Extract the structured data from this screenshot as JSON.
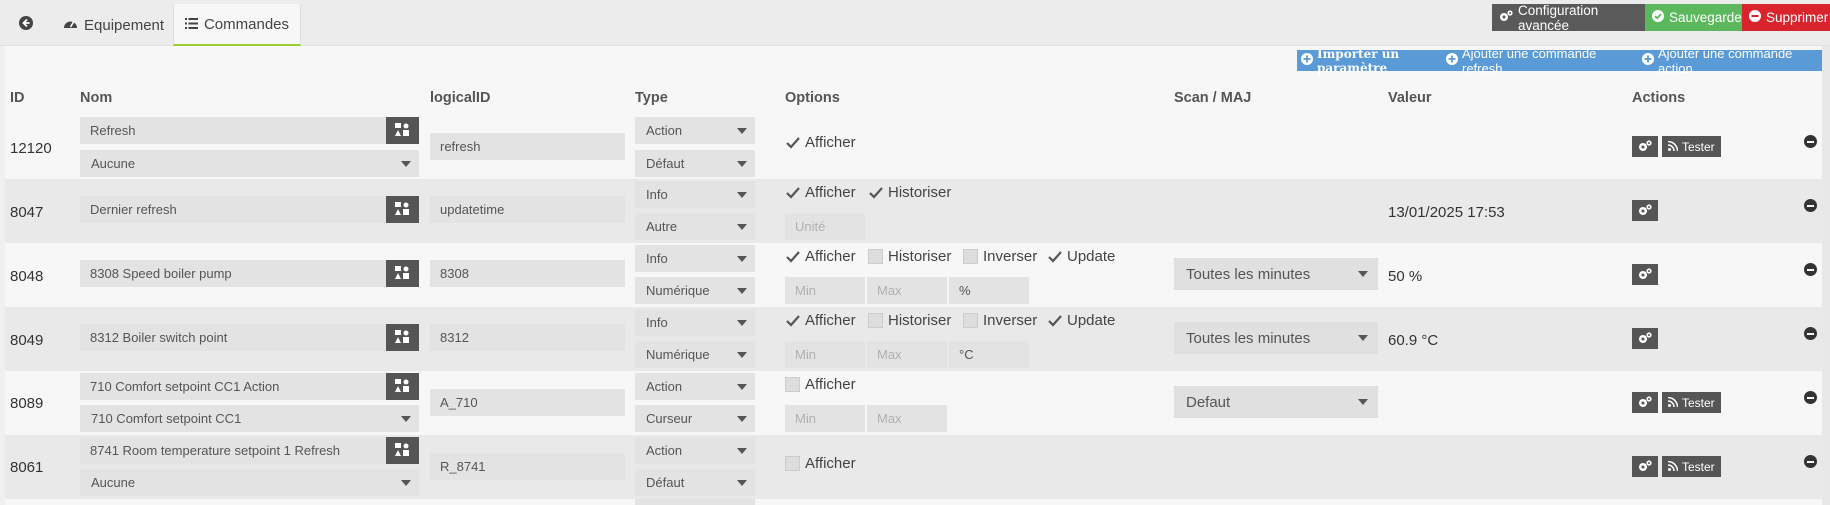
{
  "tabs": {
    "back_icon": "circle-arrow-left-icon",
    "equipement": "Equipement",
    "commandes": "Commandes"
  },
  "top_buttons": {
    "config": "Configuration avancée",
    "save": "Sauvegarder",
    "delete": "Supprimer"
  },
  "add_buttons": {
    "import_param": "Importer un paramètre",
    "add_refresh": "Ajouter une commande refresh",
    "add_action": "Ajouter une commande action"
  },
  "headers": {
    "id": "ID",
    "nom": "Nom",
    "logical": "logicalID",
    "type": "Type",
    "options": "Options",
    "scan": "Scan / MAJ",
    "valeur": "Valeur",
    "actions": "Actions"
  },
  "labels": {
    "afficher": "Afficher",
    "historiser": "Historiser",
    "inverser": "Inverser",
    "update": "Update",
    "tester": "Tester",
    "unite": "Unité",
    "min": "Min",
    "max": "Max"
  },
  "rows": [
    {
      "id": "12120",
      "nom": "Refresh",
      "nom2": "Aucune",
      "logical": "refresh",
      "type": "Action",
      "subtype": "Défaut",
      "afficher": true,
      "valeur": ""
    },
    {
      "id": "8047",
      "nom": "Dernier refresh",
      "logical": "updatetime",
      "type": "Info",
      "subtype": "Autre",
      "afficher": true,
      "historiser": true,
      "valeur": "13/01/2025 17:53"
    },
    {
      "id": "8048",
      "nom": "8308 Speed boiler pump",
      "logical": "8308",
      "type": "Info",
      "subtype": "Numérique",
      "afficher": true,
      "historiser": false,
      "inverser": false,
      "update": true,
      "unit": "%",
      "scan": "Toutes les minutes",
      "valeur": "50 %"
    },
    {
      "id": "8049",
      "nom": "8312 Boiler switch point",
      "logical": "8312",
      "type": "Info",
      "subtype": "Numérique",
      "afficher": true,
      "historiser": false,
      "inverser": false,
      "update": true,
      "unit": "°C",
      "scan": "Toutes les minutes",
      "valeur": "60.9 °C"
    },
    {
      "id": "8089",
      "nom": "710 Comfort setpoint CC1 Action",
      "nom2": "710 Comfort setpoint CC1",
      "logical": "A_710",
      "type": "Action",
      "subtype": "Curseur",
      "afficher": false,
      "scan": "Defaut",
      "valeur": ""
    },
    {
      "id": "8061",
      "nom": "8741 Room temperature setpoint 1 Refresh",
      "nom2": "Aucune",
      "logical": "R_8741",
      "type": "Action",
      "subtype": "Défaut",
      "afficher": false,
      "valeur": ""
    }
  ]
}
